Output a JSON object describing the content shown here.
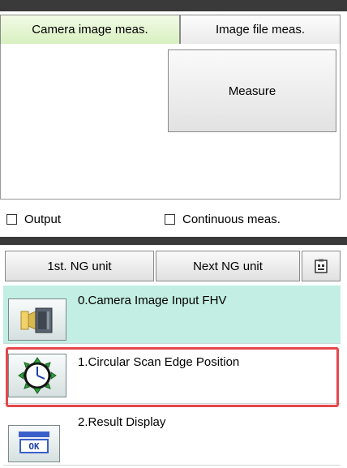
{
  "tabs": [
    {
      "label": "Camera image meas.",
      "active": true
    },
    {
      "label": "Image file meas.",
      "active": false
    }
  ],
  "measure_button": "Measure",
  "checkboxes": {
    "output": {
      "label": "Output",
      "checked": false
    },
    "continuous": {
      "label": "Continuous meas.",
      "checked": false
    }
  },
  "ng_controls": {
    "first": "1st. NG unit",
    "next": "Next NG unit",
    "settings_icon": "clipboard-icon"
  },
  "units": [
    {
      "label": "0.Camera Image Input FHV",
      "icon": "camera-icon",
      "background": "#c3eee3"
    },
    {
      "label": "1.Circular Scan Edge Position",
      "icon": "circular-scan-icon",
      "selected": true
    },
    {
      "label": "2.Result Display",
      "icon": "ok-display-icon",
      "badge": "OK"
    }
  ],
  "colors": {
    "active_tab": "#d8f0c0",
    "unit_highlight_bg": "#c3eee3",
    "selection_border": "#e5484d",
    "dark_bar": "#3a3a3a"
  }
}
